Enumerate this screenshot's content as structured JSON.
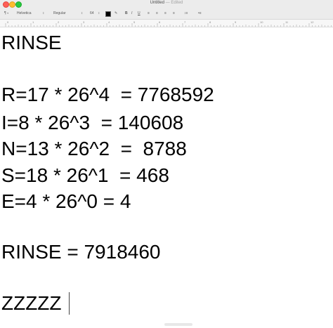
{
  "window": {
    "title": "Untitled",
    "status": "— Edited"
  },
  "toolbar": {
    "paragraph_style": "¶",
    "font_family": "Helvetica",
    "font_style": "Regular",
    "font_size": "64",
    "bold": "B",
    "italic": "I",
    "underline": "U",
    "text_color": "#000000"
  },
  "ruler": {
    "marks": [
      "0",
      "1",
      "2",
      "3",
      "4",
      "5",
      "6",
      "7",
      "8",
      "9",
      "10",
      "11",
      "12",
      "13"
    ]
  },
  "document": {
    "lines": [
      "RINSE",
      "",
      "R=17 * 26^4  = 7768592",
      "I=8 * 26^3  = 140608",
      "N=13 * 26^2  =  8788",
      "S=18 * 26^1  = 468",
      "E=4 * 26^0 = 4",
      "",
      "RINSE = 7918460",
      "",
      "ZZZZZ"
    ]
  }
}
